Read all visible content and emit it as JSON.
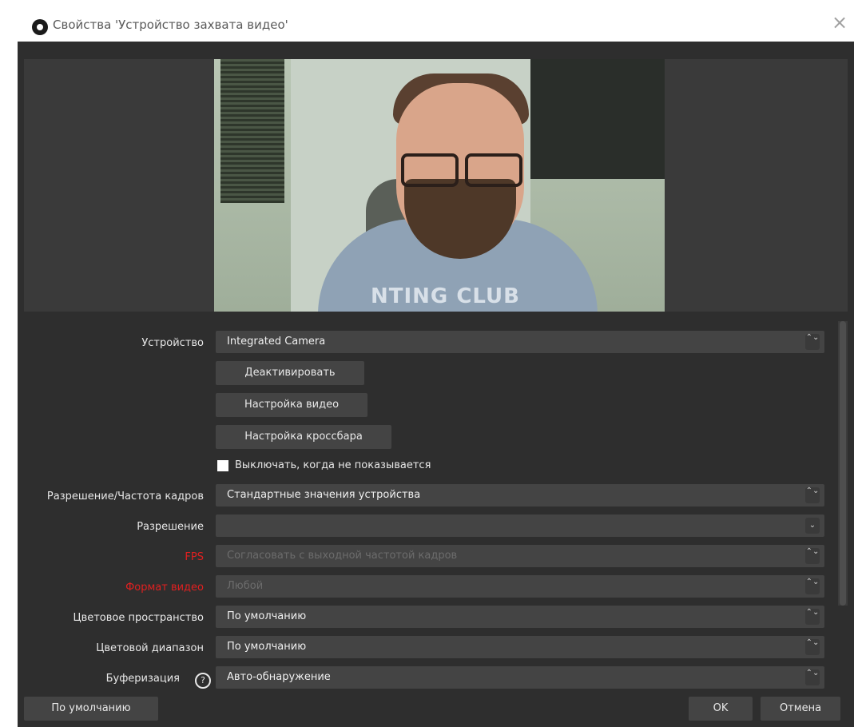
{
  "window": {
    "title": "Свойства 'Устройство захвата видео'",
    "close_glyph": "×"
  },
  "preview": {
    "shirt_text": "NTING CLUB"
  },
  "form": {
    "device_label": "Устройство",
    "device_value": "Integrated Camera",
    "deactivate_button": "Деактивировать",
    "video_settings_button": "Настройка видео",
    "crossbar_settings_button": "Настройка кроссбара",
    "hide_when_not_shown_label": "Выключать, когда не показывается",
    "resolution_fps_type_label": "Разрешение/Частота кадров",
    "resolution_fps_type_value": "Стандартные значения устройства",
    "resolution_label": "Разрешение",
    "resolution_value": "",
    "fps_label": "FPS",
    "fps_value": "Согласовать с выходной частотой кадров",
    "video_format_label": "Формат видео",
    "video_format_value": "Любой",
    "color_space_label": "Цветовое пространство",
    "color_space_value": "По умолчанию",
    "color_range_label": "Цветовой диапазон",
    "color_range_value": "По умолчанию",
    "buffering_label": "Буферизация",
    "buffering_value": "Авто-обнаружение"
  },
  "footer": {
    "defaults_button": "По умолчанию",
    "ok_button": "OK",
    "cancel_button": "Отмена"
  },
  "icons": {
    "spin": "⌃⌄",
    "dropdown": "⌄",
    "help": "?"
  },
  "colors": {
    "window_bg": "#2e2e2e",
    "field_bg": "#444444",
    "error_label": "#e02020"
  }
}
